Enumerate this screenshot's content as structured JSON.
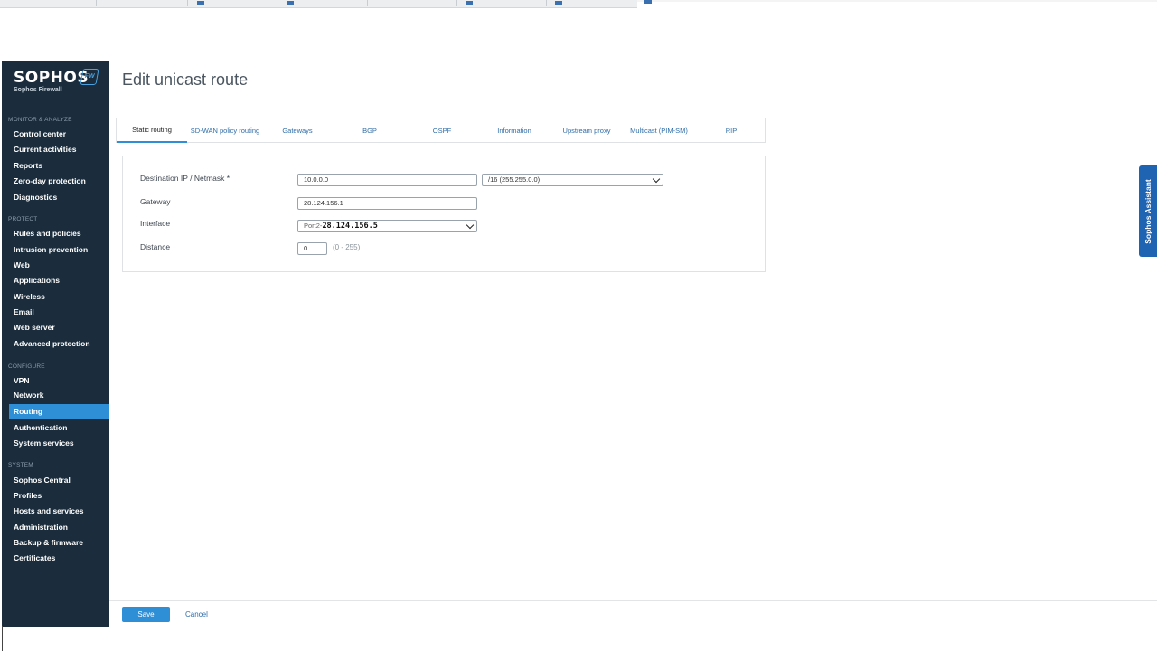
{
  "brand": {
    "logo": "SOPHOS",
    "product": "Sophos Firewall",
    "badge": "FW"
  },
  "sidebar": {
    "sections": [
      {
        "title": "MONITOR & ANALYZE",
        "items": [
          "Control center",
          "Current activities",
          "Reports",
          "Zero-day protection",
          "Diagnostics"
        ]
      },
      {
        "title": "PROTECT",
        "items": [
          "Rules and policies",
          "Intrusion prevention",
          "Web",
          "Applications",
          "Wireless",
          "Email",
          "Web server",
          "Advanced protection"
        ]
      },
      {
        "title": "CONFIGURE",
        "items": [
          "VPN",
          "Network",
          "Routing",
          "Authentication",
          "System services"
        ]
      },
      {
        "title": "SYSTEM",
        "items": [
          "Sophos Central",
          "Profiles",
          "Hosts and services",
          "Administration",
          "Backup & firmware",
          "Certificates"
        ]
      }
    ],
    "active_item": "Routing"
  },
  "page": {
    "title": "Edit unicast route"
  },
  "tabs": [
    {
      "label": "Static routing",
      "active": true
    },
    {
      "label": "SD-WAN policy routing",
      "active": false
    },
    {
      "label": "Gateways",
      "active": false
    },
    {
      "label": "BGP",
      "active": false
    },
    {
      "label": "OSPF",
      "active": false
    },
    {
      "label": "Information",
      "active": false
    },
    {
      "label": "Upstream proxy",
      "active": false
    },
    {
      "label": "Multicast (PIM-SM)",
      "active": false
    },
    {
      "label": "RIP",
      "active": false
    }
  ],
  "form": {
    "destination_label": "Destination IP / Netmask *",
    "destination_value": "10.0.0.0",
    "netmask_value": "/16 (255.255.0.0)",
    "gateway_label": "Gateway",
    "gateway_value": "28.124.156.1",
    "interface_label": "Interface",
    "interface_prefix": "Port2-",
    "interface_ip": "28.124.156.5",
    "distance_label": "Distance",
    "distance_value": "0",
    "distance_hint": "(0 - 255)"
  },
  "assistant": {
    "label": "Sophos Assistant"
  },
  "footer": {
    "save_label": "Save",
    "cancel_label": "Cancel"
  },
  "colors": {
    "sidebar_bg": "#1b2d3d",
    "accent": "#2f8fd6",
    "link": "#2f6da8",
    "assistant_bg": "#1f64b3"
  }
}
